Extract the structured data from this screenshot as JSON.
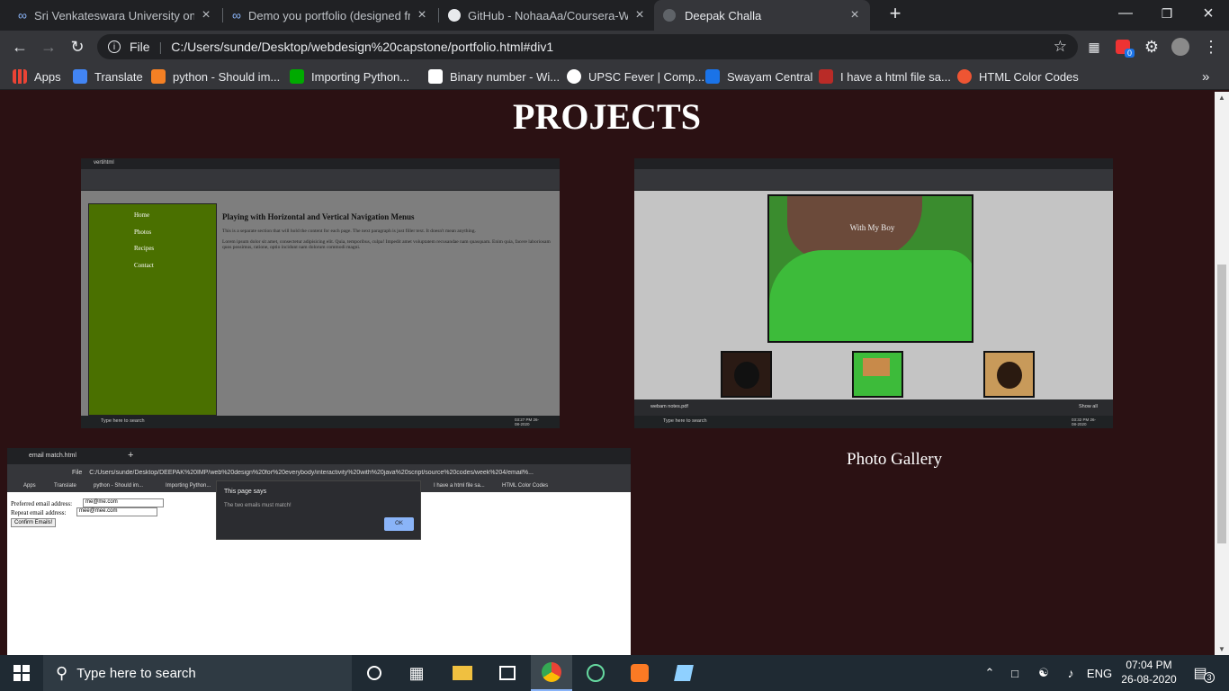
{
  "tabs": [
    {
      "title": "Sri Venkateswara University on C",
      "icon": "link-icon"
    },
    {
      "title": "Demo you portfolio (designed fro",
      "icon": "link-icon"
    },
    {
      "title": "GitHub - NohaaAa/Coursera-Wel",
      "icon": "github-icon"
    },
    {
      "title": "Deepak Challa",
      "icon": "globe-icon"
    }
  ],
  "address": {
    "scheme": "File",
    "url": "C:/Users/sunde/Desktop/webdesign%20capstone/portfolio.html#div1"
  },
  "bookmarks": [
    "Apps",
    "Translate",
    "python - Should im...",
    "Importing Python...",
    "Binary number - Wi...",
    "UPSC Fever | Comp...",
    "Swayam Central",
    "I have a html file sa...",
    "HTML Color Codes"
  ],
  "extension_badge": "0",
  "page": {
    "heading": "PROJECTS",
    "nav_shot": {
      "tab_title": "vertihtml",
      "menu": [
        "Home",
        "Photos",
        "Recipes",
        "Contact"
      ],
      "content_title": "Playing with Horizontal and Vertical Navigation Menus",
      "paragraph1": "This is a separate section that will hold the content for each page. The next paragraph is just filler text. It doesn't mean anything.",
      "paragraph2": "Lorem ipsum dolor sit amet, consectetur adipisicing elit. Quia, temporibus, culpa! Impedit amet voluptatem recusandae nam quasquam. Enim quia, facere laboriosam quos possimus, ratione, optio incidunt nam dolorum commodi magni.",
      "task_search": "Type here to search",
      "clock": "03:27 PM 26-08-2020"
    },
    "gallery_shot": {
      "overlay": "With My Boy",
      "download": "webam notes.pdf",
      "show_all": "Show all",
      "task_search": "Type here to search",
      "clock": "03:32 PM 26-08-2020"
    },
    "email_shot": {
      "tab_title": "email match.html",
      "file": "File",
      "url": "C:/Users/sunde/Desktop/DEEPAK%20IMP/web%20design%20for%20everybody/interactivity%20with%20java%20script/source%20codes/week%204/email%...",
      "bm_left": [
        "Apps",
        "Translate",
        "python - Should im...",
        "Importing Python..."
      ],
      "bm_right": [
        "I have a html file sa...",
        "HTML Color Codes"
      ],
      "label1": "Preferred email address:",
      "value1": "me@me.com",
      "label2": "Repeat email address:",
      "value2": "mee@mee.com",
      "button": "Confirm Emails!",
      "dialog_title": "This page says",
      "dialog_msg": "The two emails must match!",
      "dialog_ok": "OK"
    },
    "caption": "Photo Gallery"
  },
  "taskbar": {
    "search_placeholder": "Type here to search",
    "lang": "ENG",
    "time": "07:04 PM",
    "date": "26-08-2020",
    "notifications": "3"
  }
}
